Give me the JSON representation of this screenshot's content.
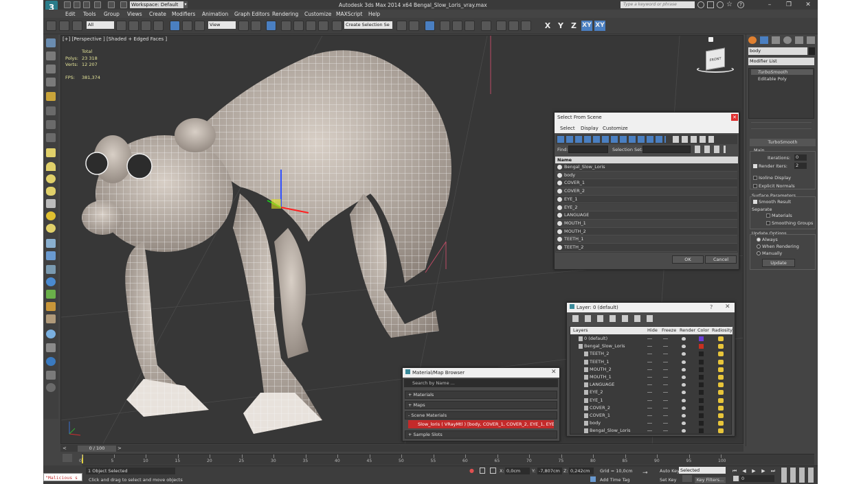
{
  "app": {
    "title": "Autodesk 3ds Max  2014 x64    Bengal_Slow_Loris_vray.max",
    "logo_letter": "3",
    "workspace": "Workspace: Default",
    "help_search_placeholder": "Type a keyword or phrase"
  },
  "menu": [
    "Edit",
    "Tools",
    "Group",
    "Views",
    "Create",
    "Modifiers",
    "Animation",
    "Graph Editors",
    "Rendering",
    "Customize",
    "MAXScript",
    "Help"
  ],
  "toolbar": {
    "selection_filter": "All",
    "ref_coord": "View",
    "named_selection": "Create Selection Se",
    "axis": [
      "X",
      "Y",
      "Z",
      "XY",
      "XY"
    ]
  },
  "viewport": {
    "label": "[+] [Perspective ] [Shaded + Edged Faces ]",
    "stats": {
      "total_label": "Total",
      "polys_label": "Polys:",
      "polys_value": "23 318",
      "verts_label": "Verts:",
      "verts_value": "12 207",
      "fps_label": "FPS:",
      "fps_value": "381,374"
    },
    "viewcube_label": "FRONT"
  },
  "command_panel": {
    "object_name": "body",
    "modifier_list": "Modifier List",
    "stack": [
      "TurboSmooth",
      "Editable Poly"
    ],
    "rollout_title": "TurboSmooth",
    "main_label": "Main",
    "iterations_label": "Iterations:",
    "iterations_value": "0",
    "render_iters_label": "Render Iters:",
    "render_iters_value": "2",
    "isoline_label": "Isoline Display",
    "explicit_normals_label": "Explicit Normals",
    "surface_params_label": "Surface Parameters",
    "smooth_result_label": "Smooth Result",
    "separate_label": "Separate",
    "materials_label": "Materials",
    "smoothing_groups_label": "Smoothing Groups",
    "update_options_label": "Update Options",
    "always_label": "Always",
    "when_rendering_label": "When Rendering",
    "manually_label": "Manually",
    "update_button": "Update"
  },
  "select_from_scene": {
    "title": "Select From Scene",
    "menu": [
      "Select",
      "Display",
      "Customize"
    ],
    "find_label": "Find:",
    "selection_set_label": "Selection Set:",
    "column_name": "Name",
    "rows": [
      "Bengal_Slow_Loris",
      "body",
      "COVER_1",
      "COVER_2",
      "EYE_1",
      "EYE_2",
      "LANGUAGE",
      "MOUTH_1",
      "MOUTH_2",
      "TEETH_1",
      "TEETH_2"
    ],
    "ok": "OK",
    "cancel": "Cancel"
  },
  "layer_dialog": {
    "title": "Layer: 0 (default)",
    "help": "?",
    "columns": [
      "Layers",
      "Hide",
      "Freeze",
      "Render",
      "Color",
      "Radiosity"
    ],
    "rows": [
      {
        "name": "0 (default)",
        "indent": 0,
        "color": "#6a3cd8"
      },
      {
        "name": "Bengal_Slow_Loris",
        "indent": 0,
        "color": "#c83020"
      },
      {
        "name": "TEETH_2",
        "indent": 1,
        "color": "#202020"
      },
      {
        "name": "TEETH_1",
        "indent": 1,
        "color": "#202020"
      },
      {
        "name": "MOUTH_2",
        "indent": 1,
        "color": "#202020"
      },
      {
        "name": "MOUTH_1",
        "indent": 1,
        "color": "#202020"
      },
      {
        "name": "LANGUAGE",
        "indent": 1,
        "color": "#202020"
      },
      {
        "name": "EYE_2",
        "indent": 1,
        "color": "#202020"
      },
      {
        "name": "EYE_1",
        "indent": 1,
        "color": "#202020"
      },
      {
        "name": "COVER_2",
        "indent": 1,
        "color": "#202020"
      },
      {
        "name": "COVER_1",
        "indent": 1,
        "color": "#202020"
      },
      {
        "name": "body",
        "indent": 1,
        "color": "#202020"
      },
      {
        "name": "Bengal_Slow_Loris",
        "indent": 1,
        "color": "#202020"
      }
    ]
  },
  "material_browser": {
    "title": "Material/Map Browser",
    "search_placeholder": "Search by Name ...",
    "categories": [
      "+ Materials",
      "+ Maps",
      "- Scene Materials"
    ],
    "scene_material": "Slow_loris  ( VRayMtl )  [body, COVER_1, COVER_2, EYE_1, EYE...",
    "sample_slots": "+ Sample Slots"
  },
  "timeline": {
    "frame_display": "0 / 100",
    "ticks": [
      "0",
      "5",
      "10",
      "15",
      "20",
      "25",
      "30",
      "35",
      "40",
      "45",
      "50",
      "55",
      "60",
      "65",
      "70",
      "75",
      "80",
      "85",
      "90",
      "95",
      "100"
    ]
  },
  "status": {
    "script_listener": "\"Malicious s",
    "selected_text": "1 Object Selected",
    "prompt_text": "Click and drag to select and move objects",
    "x_label": "X:",
    "x_value": "0,0cm",
    "y_label": "Y:",
    "y_value": "-7,807cm",
    "z_label": "Z:",
    "z_value": "0,242cm",
    "grid_text": "Grid = 10,0cm",
    "add_time_tag": "Add Time Tag",
    "auto_key": "Auto Key",
    "selected_dropdown": "Selected",
    "set_key": "Set Key",
    "key_filters": "Key Filters...",
    "frame_value": "0"
  },
  "colors": {
    "accent": "#4a7fc1",
    "viewport_bg": "#373737",
    "ui_bg": "#444444"
  }
}
